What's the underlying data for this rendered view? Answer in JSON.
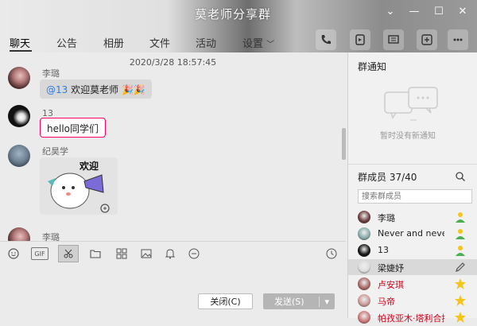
{
  "window": {
    "title": "莫老师分享群",
    "controls": [
      "chevron-down",
      "minimize",
      "maximize",
      "close"
    ]
  },
  "nav": {
    "tabs": [
      "聊天",
      "公告",
      "相册",
      "文件",
      "活动",
      "设置"
    ],
    "active": "聊天",
    "settings_chevron": "﹀"
  },
  "toolbar_icons": [
    "phone-icon",
    "video-icon",
    "screen-share-icon",
    "add-app-icon",
    "more-icon"
  ],
  "chat": {
    "timestamp": "2020/3/28 18:57:45",
    "messages": [
      {
        "sender": "李璐",
        "at": "@13",
        "text": "欢迎莫老师"
      },
      {
        "sender": "13",
        "text": "hello同学们"
      },
      {
        "sender": "纪昊学",
        "sticker_text": "欢迎"
      },
      {
        "sender": "李璐"
      }
    ]
  },
  "input_toolbar": [
    "emoji-icon",
    "gif-icon",
    "scissors-icon",
    "folder-icon",
    "image-gallery-icon",
    "picture-icon",
    "bell-icon",
    "more-circle-icon",
    "history-clock-icon"
  ],
  "input_toolbar_gif": "GIF",
  "buttons": {
    "close": "关闭(C)",
    "send": "发送(S)",
    "send_dropdown": "▾"
  },
  "right": {
    "notice_title": "群通知",
    "notice_empty": "暂时没有新通知",
    "members_title": "群成员 37/40",
    "search_placeholder": "搜索群成员",
    "members": [
      {
        "name": "李璐",
        "role": "admin"
      },
      {
        "name": "Never and neve",
        "role": "admin"
      },
      {
        "name": "13",
        "role": "admin"
      },
      {
        "name": "梁婕妤",
        "role": "edit",
        "selected": true
      },
      {
        "name": "卢安琪",
        "role": "owner",
        "red": true
      },
      {
        "name": "马帝",
        "role": "owner",
        "red": true
      },
      {
        "name": "帕孜亚木·塔利合提",
        "role": "owner",
        "red": true
      }
    ]
  },
  "colors": {
    "accent_blue": "#2c7be5",
    "owner_red": "#d0021b",
    "admin_green": "#4caf50",
    "owner_gold": "#f5c518"
  }
}
